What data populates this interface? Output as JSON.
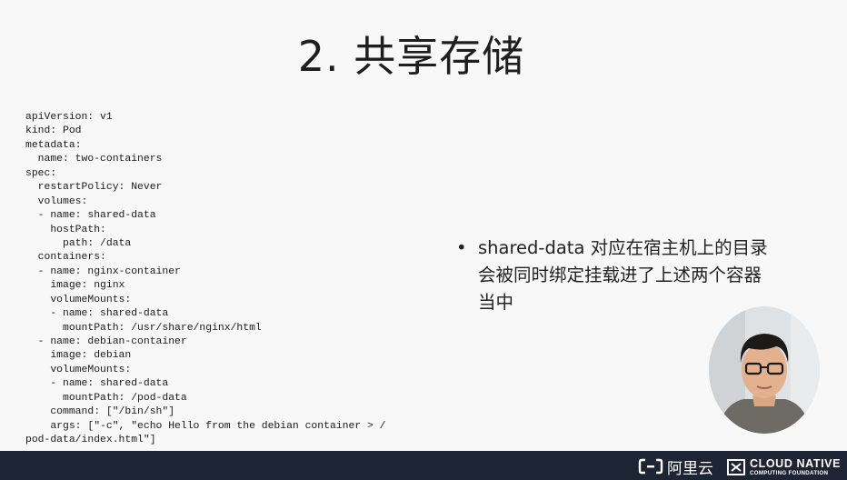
{
  "slide": {
    "title": "2. 共享存储",
    "code_lines": [
      "apiVersion: v1",
      "kind: Pod",
      "metadata:",
      "  name: two-containers",
      "spec:",
      "  restartPolicy: Never",
      "  volumes:",
      "  - name: shared-data",
      "    hostPath:",
      "      path: /data",
      "  containers:",
      "  - name: nginx-container",
      "    image: nginx",
      "    volumeMounts:",
      "    - name: shared-data",
      "      mountPath: /usr/share/nginx/html",
      "  - name: debian-container",
      "    image: debian",
      "    volumeMounts:",
      "    - name: shared-data",
      "      mountPath: /pod-data",
      "    command: [\"/bin/sh\"]",
      "    args: [\"-c\", \"echo Hello from the debian container > /",
      "pod-data/index.html\"]"
    ],
    "bullet_symbol": "•",
    "bullet_lines": [
      "shared-data 对应在宿主机上的目录",
      "会被同时绑定挂载进了上述两个容器",
      "当中"
    ]
  },
  "footer": {
    "aliyun_text": "阿里云",
    "cncf_line1": "CLOUD NATIVE",
    "cncf_line2": "COMPUTING FOUNDATION"
  },
  "colors": {
    "background": "#f8f8f8",
    "text": "#1e1e1e",
    "footer_bg": "#1d2433",
    "footer_text": "#ffffff"
  },
  "icons": {
    "aliyun_logo": "aliyun-logo-icon",
    "cncf_logo": "cncf-logo-icon",
    "presenter": "presenter-avatar"
  }
}
